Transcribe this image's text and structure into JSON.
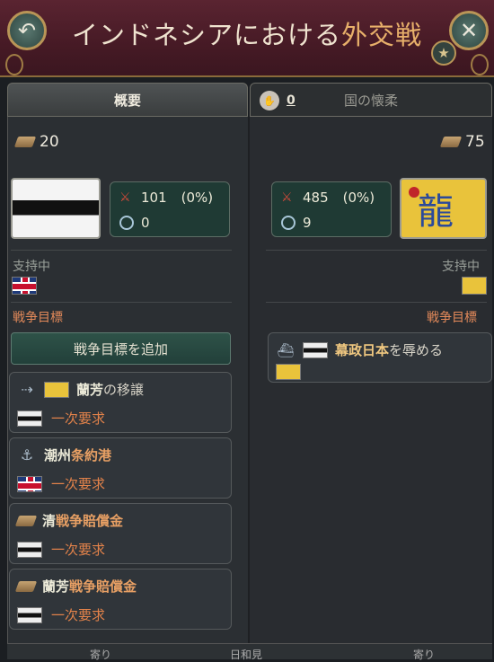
{
  "header": {
    "title_pre": "インドネシアにおける",
    "title_hl": "外交戦",
    "back_icon": "↶",
    "close_icon": "✕",
    "star_icon": "★"
  },
  "tabs": {
    "overview": "概要",
    "appease_count": "0",
    "appease": "国の懐柔"
  },
  "left": {
    "amount": "20",
    "army": "101",
    "army_pct": "(0%)",
    "navy": "0",
    "support_label": "支持中",
    "goals_label": "戦争目標",
    "add_goal": "戦争目標を追加",
    "goals": [
      {
        "target": "蘭芳",
        "action": "の移譲",
        "demand": "一次要求"
      },
      {
        "target": "潮州",
        "action": "条約港",
        "demand": "一次要求"
      },
      {
        "target": "清",
        "action": "戦争賠償金",
        "demand": "一次要求"
      },
      {
        "target": "蘭芳",
        "action": "戦争賠償金",
        "demand": "一次要求"
      }
    ]
  },
  "right": {
    "amount": "75",
    "army": "485",
    "army_pct": "(0%)",
    "navy": "9",
    "support_label": "支持中",
    "goals_label": "戦争目標",
    "goal": {
      "target": "幕政日本",
      "action": "を辱める"
    }
  },
  "footer": {
    "left": "寄り",
    "mid": "日和見",
    "right": "寄り"
  },
  "colors": {
    "header": "#4a1b27",
    "accent_gold": "#b99557",
    "goal_orange": "#e48a5a"
  }
}
